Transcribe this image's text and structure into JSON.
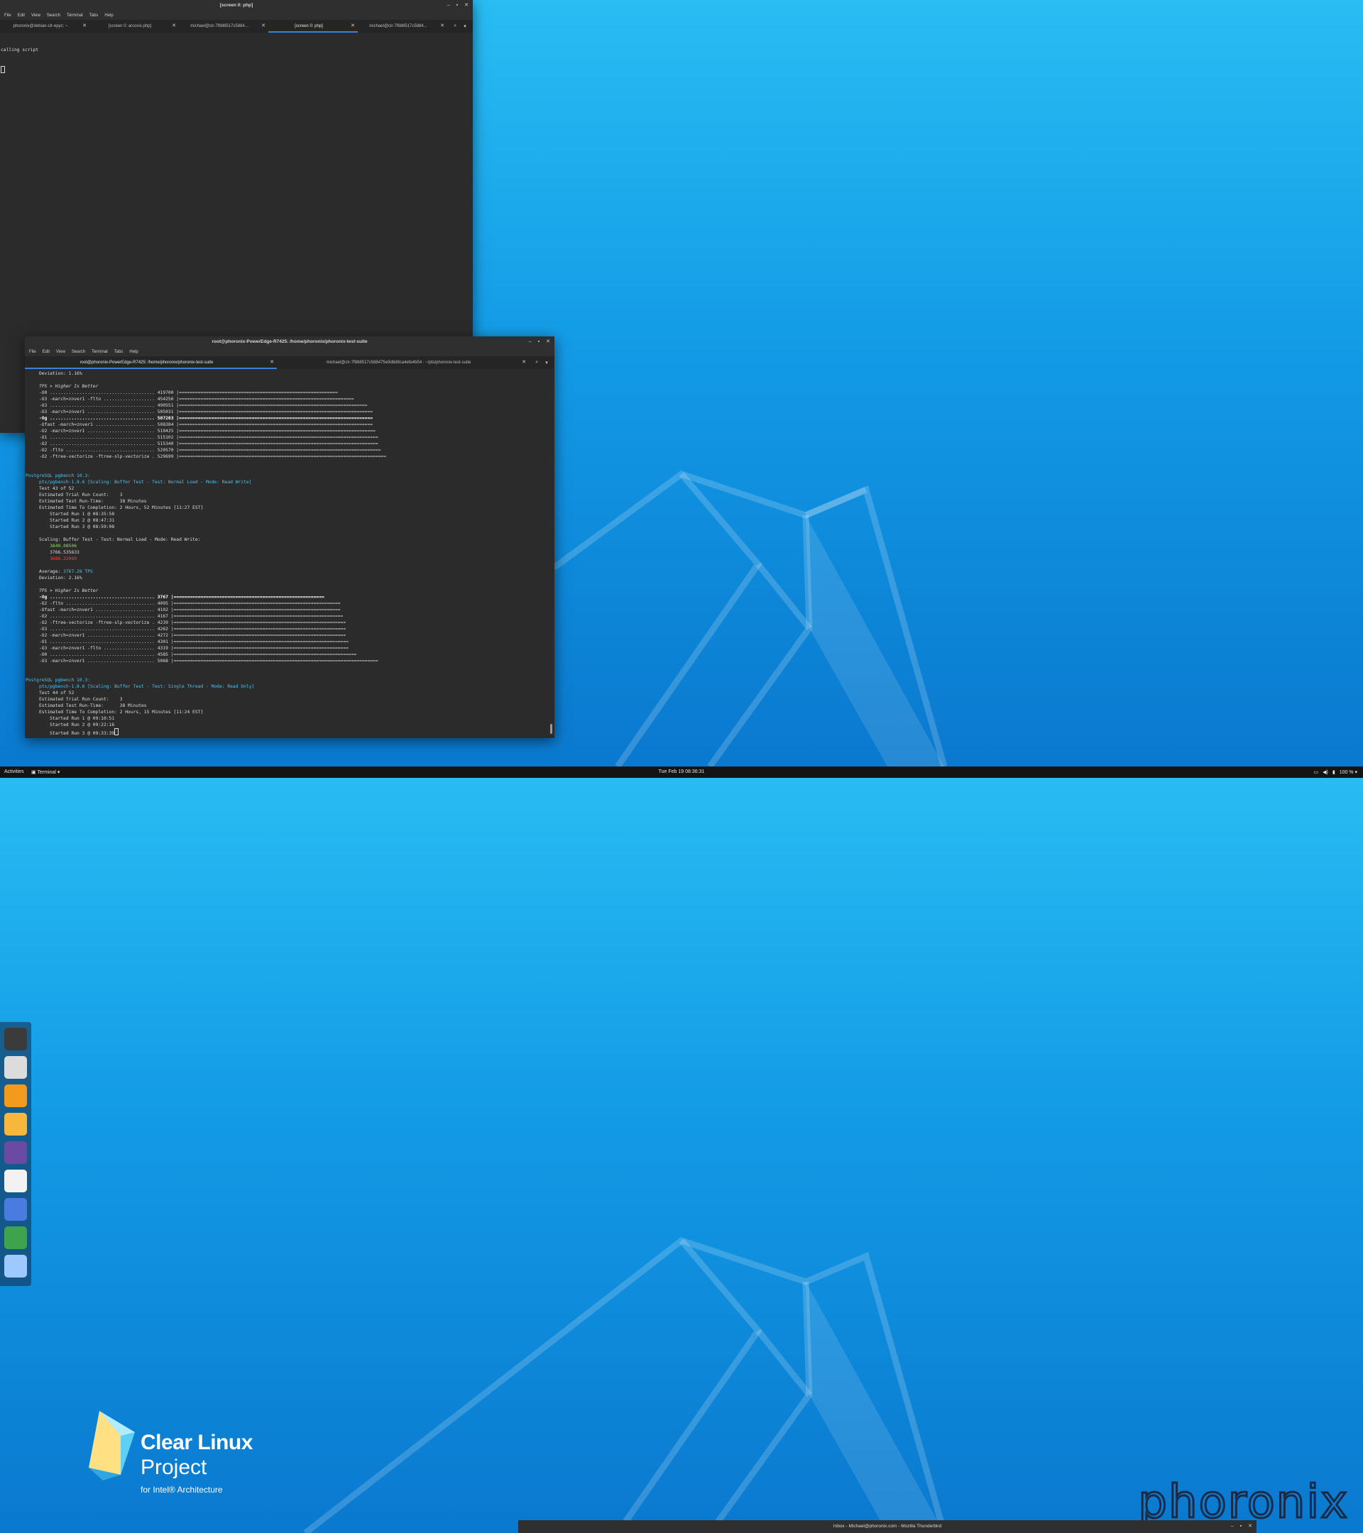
{
  "topbar": {
    "activities": "Activities",
    "app_menu": "Terminal ▾",
    "clock": "Tue Feb 19  08:36:31",
    "battery": "100 % ▾"
  },
  "menu": [
    "File",
    "Edit",
    "View",
    "Search",
    "Terminal",
    "Tabs",
    "Help"
  ],
  "window_a": {
    "title": "[screen 0: php]",
    "tabs": [
      "phoronix@debian-clr-epyc: ~",
      "[screen 0: arcovix.php]",
      "michael@clr-7f888517c5884...",
      "[screen 0: php]",
      "michael@clr-7f888517c5884..."
    ],
    "active_tab": 3,
    "lines": [
      "calling script"
    ]
  },
  "window_b": {
    "title": "root@phoronix-PowerEdge-R7425: /home/phoronix/phoronix-test-suite",
    "tabs": [
      "root@phoronix-PowerEdge-R7425: /home/phoronix/phoronix-test-suite",
      "michael@clr-7f888517c588475e9d8d8ca4efe4b54 : ~/pts/phoronix-test-suite"
    ],
    "active_tab": 0,
    "lines": [
      {
        "t": "     Deviation: 1.16%"
      },
      {
        "t": ""
      },
      {
        "t": "     TPS > Higher Is Better",
        "c": "ital"
      },
      {
        "t": "     -O0 ....................................... 419700 |==========================================================="
      },
      {
        "t": "     -O3 -march=znver1 -flto ................... 454256 |================================================================="
      },
      {
        "t": "     -O3 ....................................... 490551 |======================================================================"
      },
      {
        "t": "     -O3 -march=znver1 ......................... 505031 |========================================================================"
      },
      {
        "t": "     -Og ....................................... 507203 |========================================================================",
        "c": "bold"
      },
      {
        "t": "     -Ofast -march=znver1 ...................... 508384 |========================================================================"
      },
      {
        "t": "     -O2 -march=znver1 ......................... 510425 |========================================================================="
      },
      {
        "t": "     -O1 ....................................... 515102 |=========================================================================="
      },
      {
        "t": "     -O2 ....................................... 515340 |=========================================================================="
      },
      {
        "t": "     -O2 -flto ................................. 520570 |==========================================================================="
      },
      {
        "t": "     -O2 -ftree-vectorize -ftree-slp-vectorize . 529699 |============================================================================="
      },
      {
        "t": ""
      },
      {
        "t": ""
      },
      {
        "t": "PostgreSQL pgbench 10.3:",
        "c": "cyan"
      },
      {
        "t": "     pts/pgbench-1.8.6 [Scaling: Buffer Test - Test: Normal Load - Mode: Read Write]",
        "c": "cyan"
      },
      {
        "t": "     Test 43 of 52"
      },
      {
        "t": "     Estimated Trial Run Count:    3"
      },
      {
        "t": "     Estimated Test Run-Time:      38 Minutes"
      },
      {
        "t": "     Estimated Time To Completion: 2 Hours, 52 Minutes [11:27 EST]"
      },
      {
        "t": "         Started Run 1 @ 08:35:58"
      },
      {
        "t": "         Started Run 2 @ 08:47:31"
      },
      {
        "t": "         Started Run 3 @ 08:59:08"
      },
      {
        "t": ""
      },
      {
        "t": "     Scaling: Buffer Test - Test: Normal Load - Mode: Read Write:"
      },
      {
        "t": "         3849.08506",
        "c": "green"
      },
      {
        "t": "         3766.535633"
      },
      {
        "t": "         3686.22069",
        "c": "red"
      },
      {
        "t": ""
      },
      {
        "t": "     Average: 3767.28 TPS",
        "c": "avg"
      },
      {
        "t": "     Deviation: 2.16%"
      },
      {
        "t": ""
      },
      {
        "t": "     TPS > Higher Is Better",
        "c": "ital"
      },
      {
        "t": "     -Og ....................................... 3767 |========================================================",
        "c": "bold"
      },
      {
        "t": "     -O2 -flto ................................. 4095 |=============================================================="
      },
      {
        "t": "     -Ofast -march=znver1 ...................... 4102 |=============================================================="
      },
      {
        "t": "     -O2 ....................................... 4167 |==============================================================="
      },
      {
        "t": "     -O2 -ftree-vectorize -ftree-slp-vectorize . 4239 |================================================================"
      },
      {
        "t": "     -O3 ....................................... 4262 |================================================================"
      },
      {
        "t": "     -O2 -march=znver1 ......................... 4272 |================================================================"
      },
      {
        "t": "     -O1 ....................................... 4301 |================================================================="
      },
      {
        "t": "     -O3 -march=znver1 -flto ................... 4319 |================================================================="
      },
      {
        "t": "     -O0 ....................................... 4585 |===================================================================="
      },
      {
        "t": "     -O3 -march=znver1 ......................... 5068 |============================================================================"
      },
      {
        "t": ""
      },
      {
        "t": ""
      },
      {
        "t": "PostgreSQL pgbench 10.3:",
        "c": "cyan"
      },
      {
        "t": "     pts/pgbench-1.8.6 [Scaling: Buffer Test - Test: Single Thread - Mode: Read Only]",
        "c": "cyan"
      },
      {
        "t": "     Test 44 of 52"
      },
      {
        "t": "     Estimated Trial Run Count:    3"
      },
      {
        "t": "     Estimated Test Run-Time:      38 Minutes"
      },
      {
        "t": "     Estimated Time To Completion: 2 Hours, 15 Minutes [11:24 EST]"
      },
      {
        "t": "         Started Run 1 @ 09:10:51"
      },
      {
        "t": "         Started Run 2 @ 09:22:16"
      },
      {
        "t": "         Started Run 3 @ 09:33:39",
        "c": "cursor"
      }
    ]
  },
  "dock": [
    {
      "name": "terminal",
      "color": "#3b3b3b"
    },
    {
      "name": "files",
      "color": "#dcdcdc"
    },
    {
      "name": "firefox",
      "color": "#f29a1c"
    },
    {
      "name": "mail",
      "color": "#f6b73c"
    },
    {
      "name": "chat",
      "color": "#6b4aa3"
    },
    {
      "name": "pdf",
      "color": "#f2f2f2"
    },
    {
      "name": "notes",
      "color": "#4a7be0"
    },
    {
      "name": "chrome",
      "color": "#3fa34d"
    },
    {
      "name": "apps",
      "color": "#9ec9ff"
    }
  ],
  "logo": {
    "line1": "Clear Linux",
    "line2": "Project",
    "line3": "for Intel® Architecture"
  },
  "watermark": "phoronix",
  "thunderbird_title": "Inbox - Michael@phoronix.com - Mozilla Thunderbird",
  "colors": {
    "accent": "#3d7fd9",
    "cyan": "#4fc3ec",
    "green": "#8fe05a",
    "red": "#ec4747"
  }
}
